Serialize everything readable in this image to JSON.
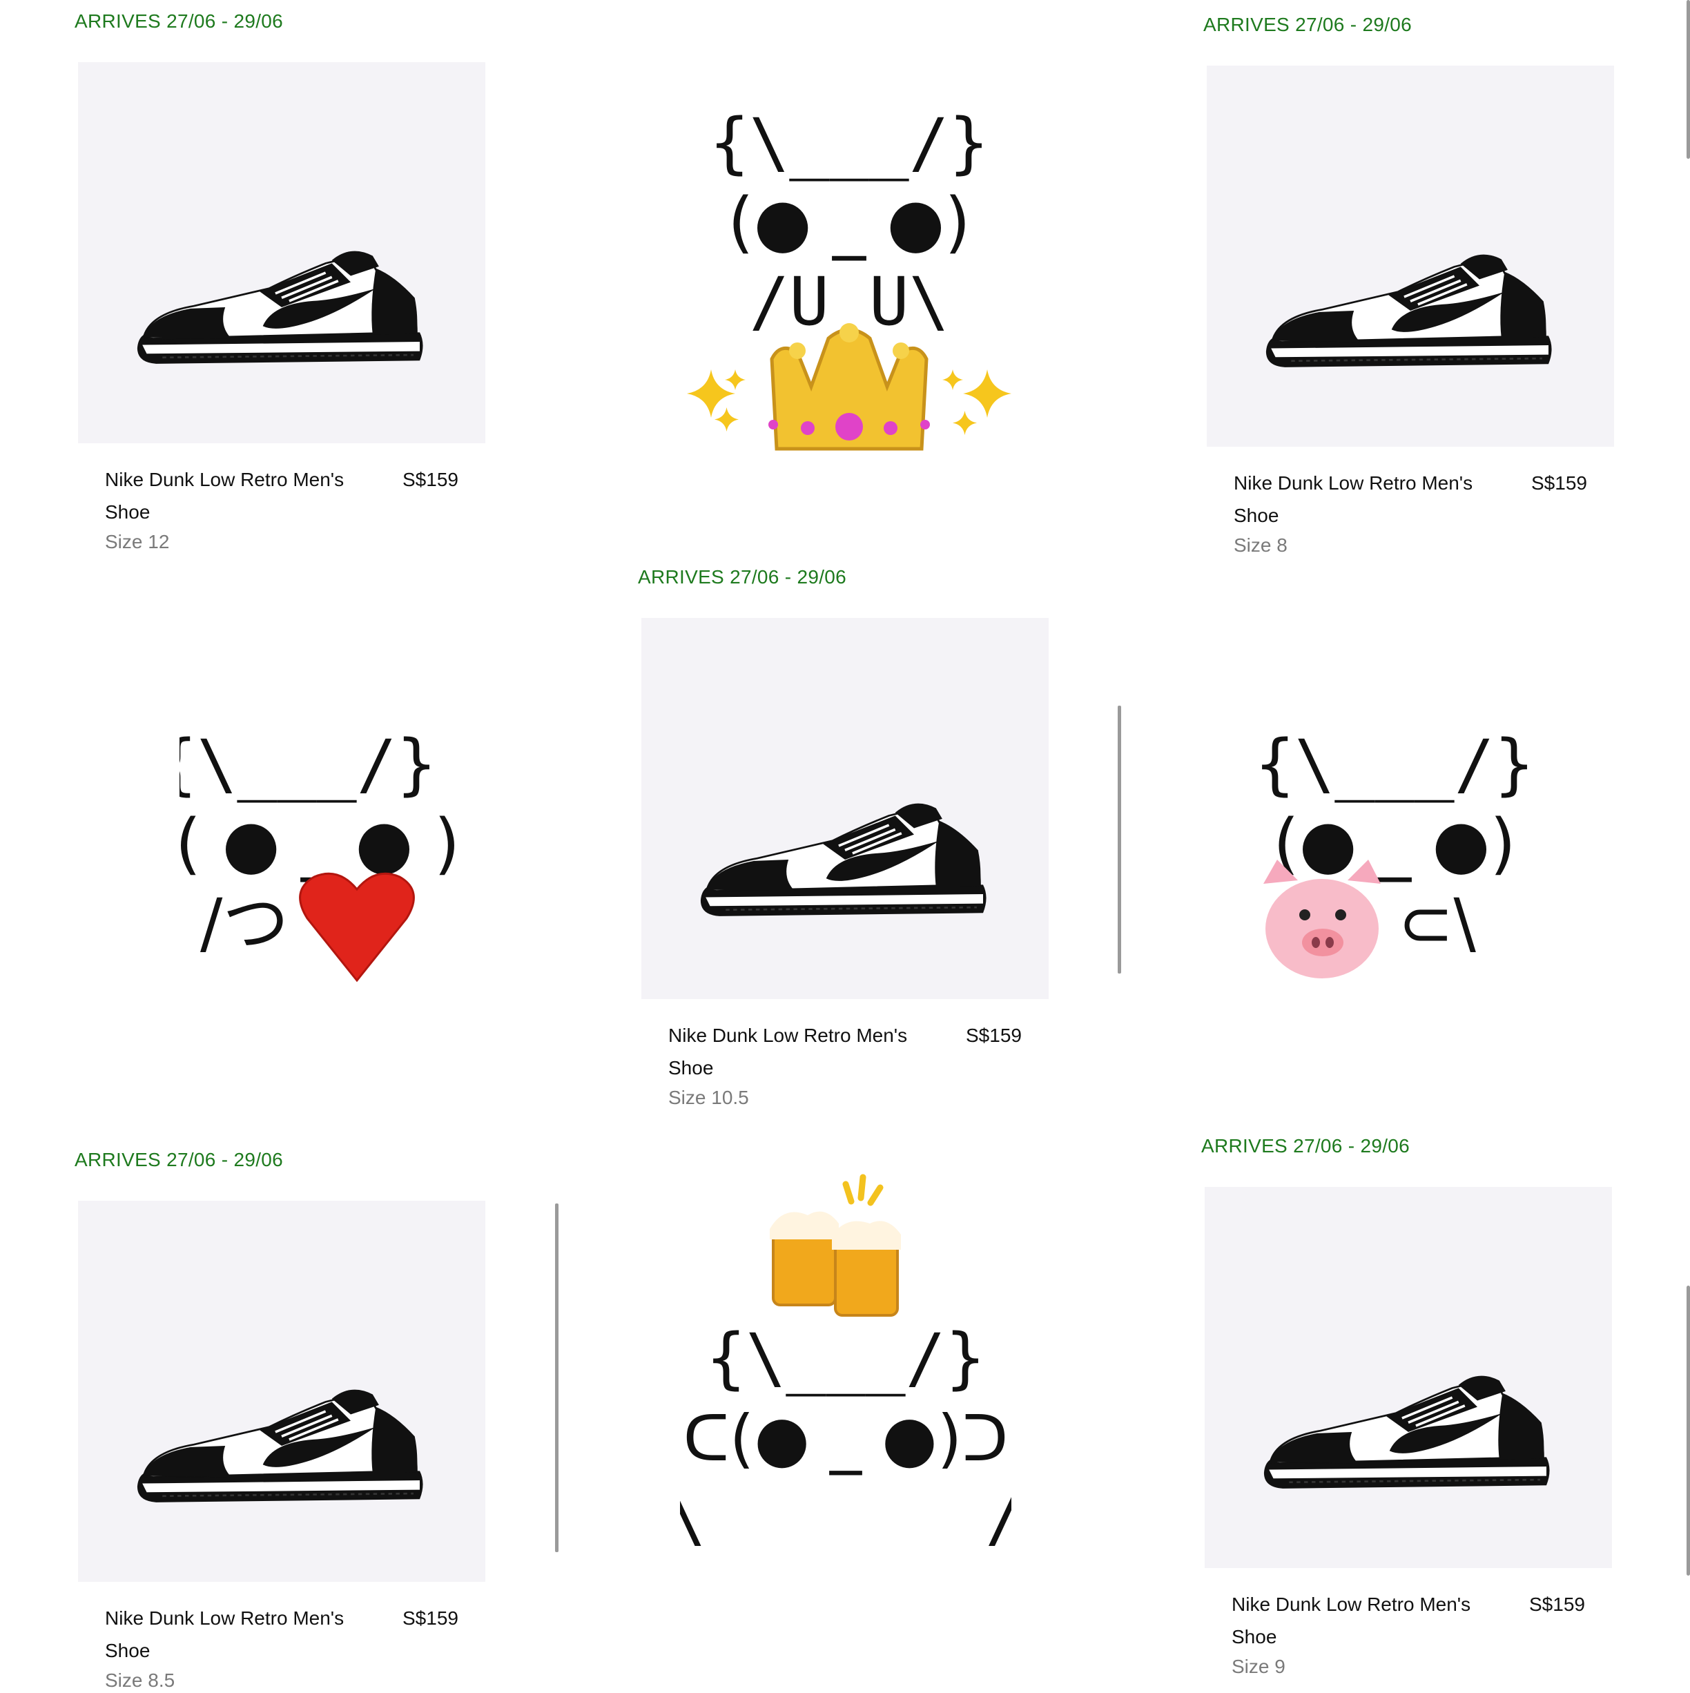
{
  "products": [
    {
      "arrives": "ARRIVES 27/06 - 29/06",
      "name": "Nike Dunk Low Retro Men's Shoe",
      "price": "S$159",
      "size": "Size 12",
      "image_icon": "sneaker-image"
    },
    {
      "arrives": "ARRIVES 27/06 - 29/06",
      "name": "Nike Dunk Low Retro Men's Shoe",
      "price": "S$159",
      "size": "Size 8",
      "image_icon": "sneaker-image"
    },
    {
      "arrives": "ARRIVES 27/06 - 29/06",
      "name": "Nike Dunk Low Retro Men's Shoe",
      "price": "S$159",
      "size": "Size 10.5",
      "image_icon": "sneaker-image"
    },
    {
      "arrives": "ARRIVES 27/06 - 29/06",
      "name": "Nike Dunk Low Retro Men's Shoe",
      "price": "S$159",
      "size": "Size 8.5",
      "image_icon": "sneaker-image"
    },
    {
      "arrives": "ARRIVES 27/06 - 29/06",
      "name": "Nike Dunk Low Retro Men's Shoe",
      "price": "S$159",
      "size": "Size 9",
      "image_icon": "sneaker-image"
    }
  ],
  "ascii_art": [
    {
      "ears": "{\\___/}",
      "face": "(● _ ●)",
      "arms": "/U   U\\",
      "emoji": "crown-with-sparkles"
    },
    {
      "ears": "{\\___/}",
      "face": "( ● _ ● )",
      "arms": "/つ",
      "emoji": "red-heart"
    },
    {
      "ears": "{\\___/}",
      "face": "(● _ ●)",
      "arms": "⊂\\",
      "emoji": "pig-face"
    },
    {
      "ears": "{\\___/}",
      "face": "ᑕ(● _ ●)ᑐ",
      "arms": "\\       /",
      "emoji": "clinking-beer-mugs"
    }
  ],
  "colors": {
    "arrives_green": "#1e7a1e",
    "photo_bg": "#f4f3f7",
    "size_gray": "#7a7a7a"
  }
}
